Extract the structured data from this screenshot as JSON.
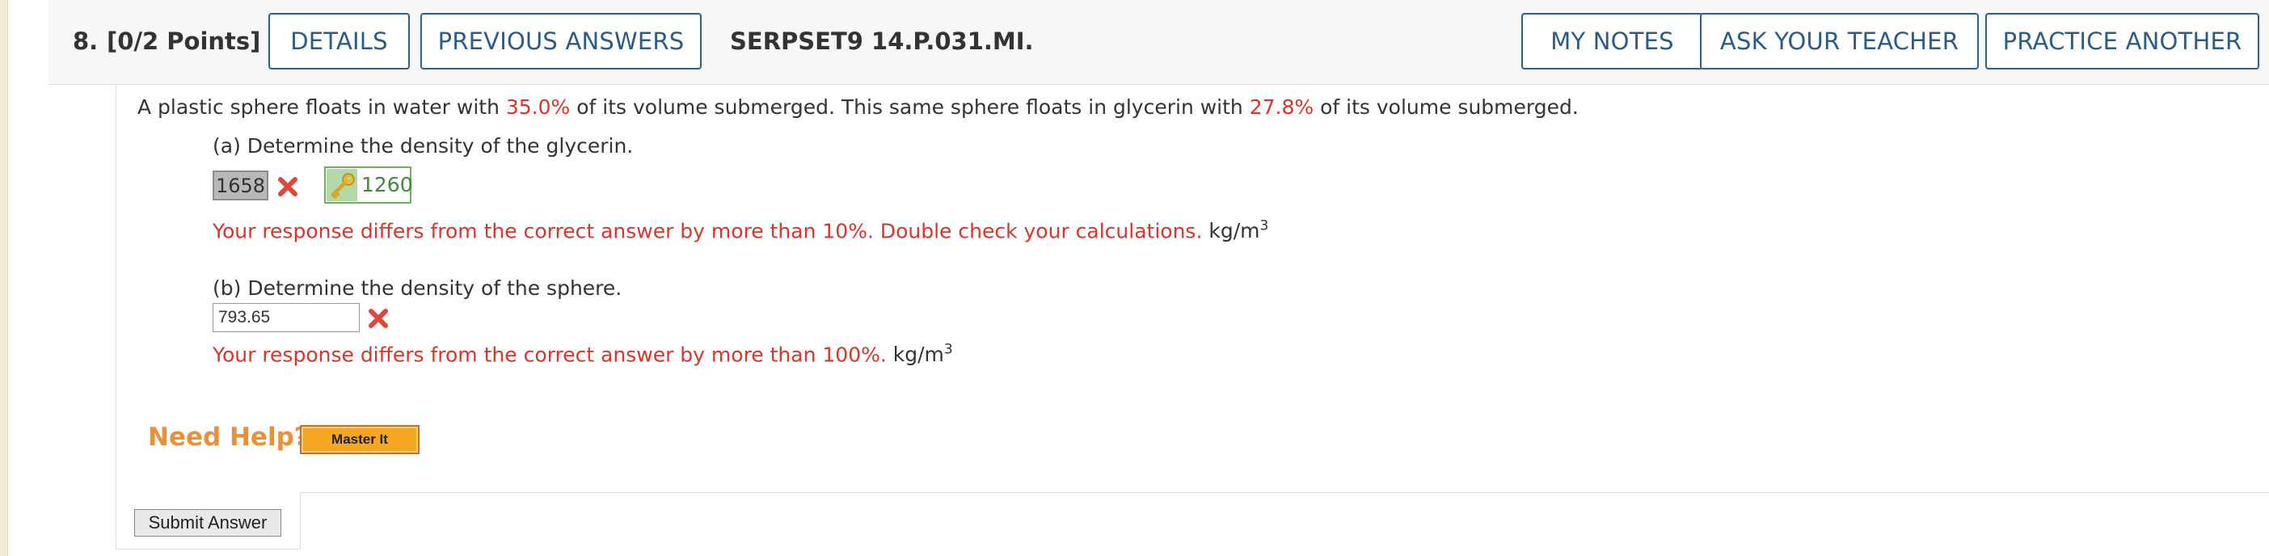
{
  "question": {
    "number": "8.",
    "points": "[0/2 Points]",
    "code": "SERPSET9 14.P.031.MI."
  },
  "toolbar": {
    "details": "DETAILS",
    "previous_answers": "PREVIOUS ANSWERS",
    "my_notes": "MY NOTES",
    "ask_teacher": "ASK YOUR TEACHER",
    "practice_another": "PRACTICE ANOTHER"
  },
  "statement": {
    "p1": "A plastic sphere floats in water with ",
    "v1": "35.0%",
    "p2": " of its volume submerged. This same sphere floats in glycerin with ",
    "v2": "27.8%",
    "p3": " of its volume submerged."
  },
  "part_a": {
    "prompt": "(a) Determine the density of the glycerin.",
    "entered": "1658",
    "correct": "1260",
    "feedback": "Your response differs from the correct answer by more than 10%. Double check your calculations.",
    "unit": "kg/m",
    "unit_exp": "3"
  },
  "part_b": {
    "prompt": "(b) Determine the density of the sphere.",
    "entered": "793.65",
    "feedback": "Your response differs from the correct answer by more than 100%.",
    "unit": "kg/m",
    "unit_exp": "3"
  },
  "help": {
    "label": "Need Help?",
    "master_it": "Master It"
  },
  "submit": "Submit Answer",
  "icons": {
    "wrong": "x-mark-icon",
    "key": "key-icon"
  },
  "colors": {
    "accent": "#2b5c87",
    "error": "#d9352b",
    "correct": "#3d8b3d",
    "help": "#e8903a"
  }
}
